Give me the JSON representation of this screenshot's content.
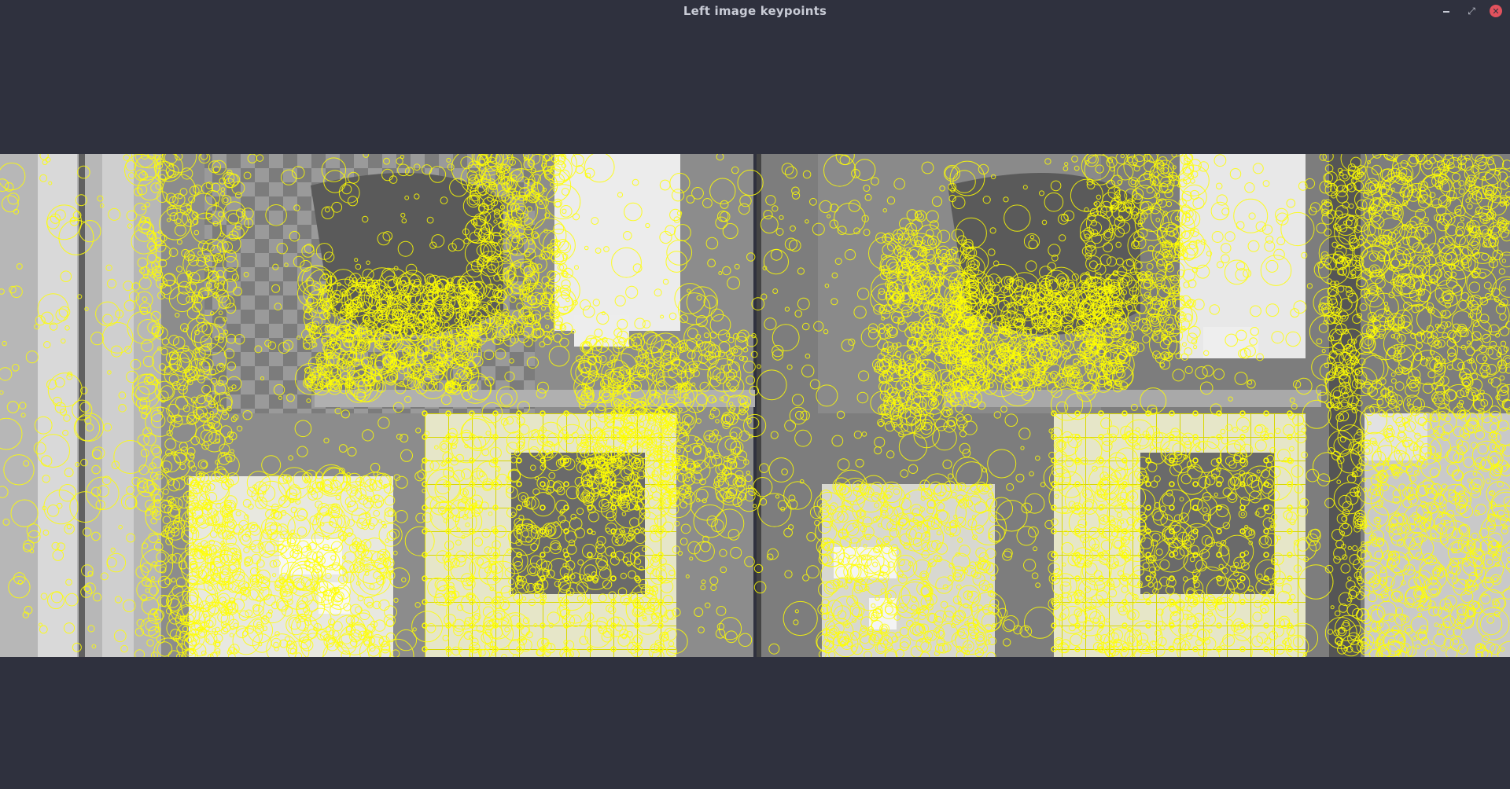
{
  "window": {
    "title": "Left image keypoints",
    "controls": {
      "minimize": "minimize-icon",
      "maximize": "maximize-icon",
      "close": "close-icon"
    }
  },
  "image": {
    "description_icon": "keypoint-visualization",
    "panels": [
      "left-aerial-image",
      "right-aerial-image"
    ],
    "colors": {
      "keypoint": "#ffff00",
      "background": "#2f313e",
      "image_gray": "#8a8a8a"
    }
  }
}
